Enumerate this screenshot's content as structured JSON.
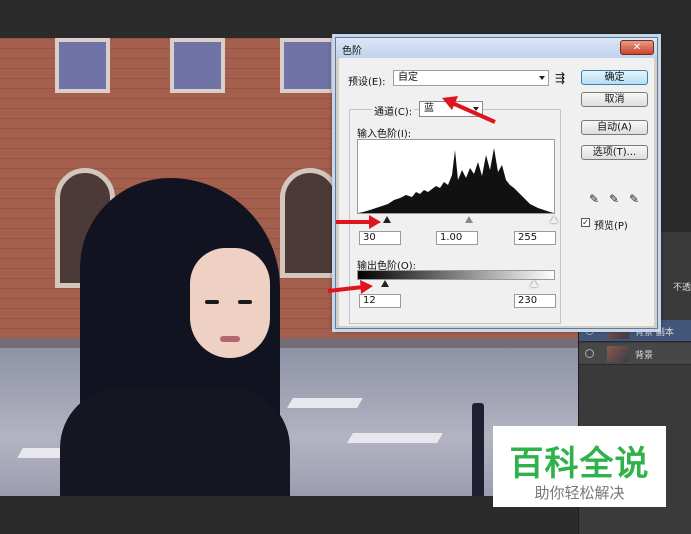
{
  "dialog": {
    "title": "色阶",
    "close_icon": "close-icon",
    "preset_label": "预设(E):",
    "preset_value": "自定",
    "channel_label": "通道(C):",
    "channel_value": "蓝",
    "input_levels_label": "输入色阶(I):",
    "input_black": "30",
    "input_gamma": "1.00",
    "input_white": "255",
    "output_levels_label": "输出色阶(O):",
    "output_black": "12",
    "output_white": "230",
    "buttons": {
      "ok": "确定",
      "cancel": "取消",
      "auto": "自动(A)",
      "options": "选项(T)..."
    },
    "preview_label": "预览(P)",
    "preview_checked": true
  },
  "layers": {
    "opacity_label": "不透",
    "items": [
      {
        "name": "背景 副本",
        "selected": true
      },
      {
        "name": "背景",
        "selected": false
      }
    ]
  },
  "watermark": {
    "title": "百科全说",
    "subtitle": "助你轻松解决"
  },
  "colors": {
    "accent_arrow": "#e0141e",
    "watermark_green": "#2fb24a"
  }
}
